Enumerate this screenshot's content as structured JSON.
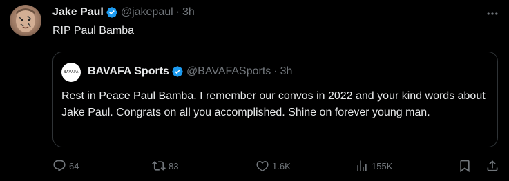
{
  "tweet": {
    "author": {
      "display_name": "Jake Paul",
      "handle": "@jakepaul",
      "verified_icon": "verified-badge-icon"
    },
    "separator": "·",
    "time": "3h",
    "text": "RIP Paul Bamba",
    "more_icon": "more-horizontal-icon"
  },
  "quote": {
    "avatar_text": "BAVAFA",
    "author": {
      "display_name": "BAVAFA Sports",
      "handle": "@BAVAFASports",
      "verified_icon": "verified-badge-icon"
    },
    "separator": "·",
    "time": "3h",
    "text": "Rest in Peace Paul Bamba. I remember our convos in 2022 and your kind words about Jake Paul. Congrats on all you accomplished. Shine on forever young man."
  },
  "actions": {
    "reply": {
      "icon": "reply-icon",
      "count": "64"
    },
    "retweet": {
      "icon": "retweet-icon",
      "count": "83"
    },
    "like": {
      "icon": "heart-icon",
      "count": "1.6K"
    },
    "views": {
      "icon": "analytics-icon",
      "count": "155K"
    },
    "bookmark": {
      "icon": "bookmark-icon"
    },
    "share": {
      "icon": "share-icon"
    }
  },
  "colors": {
    "background": "#000000",
    "primary_text": "#e7e9ea",
    "secondary_text": "#71767b",
    "border": "#2f3336",
    "verified_blue": "#1d9bf0"
  }
}
